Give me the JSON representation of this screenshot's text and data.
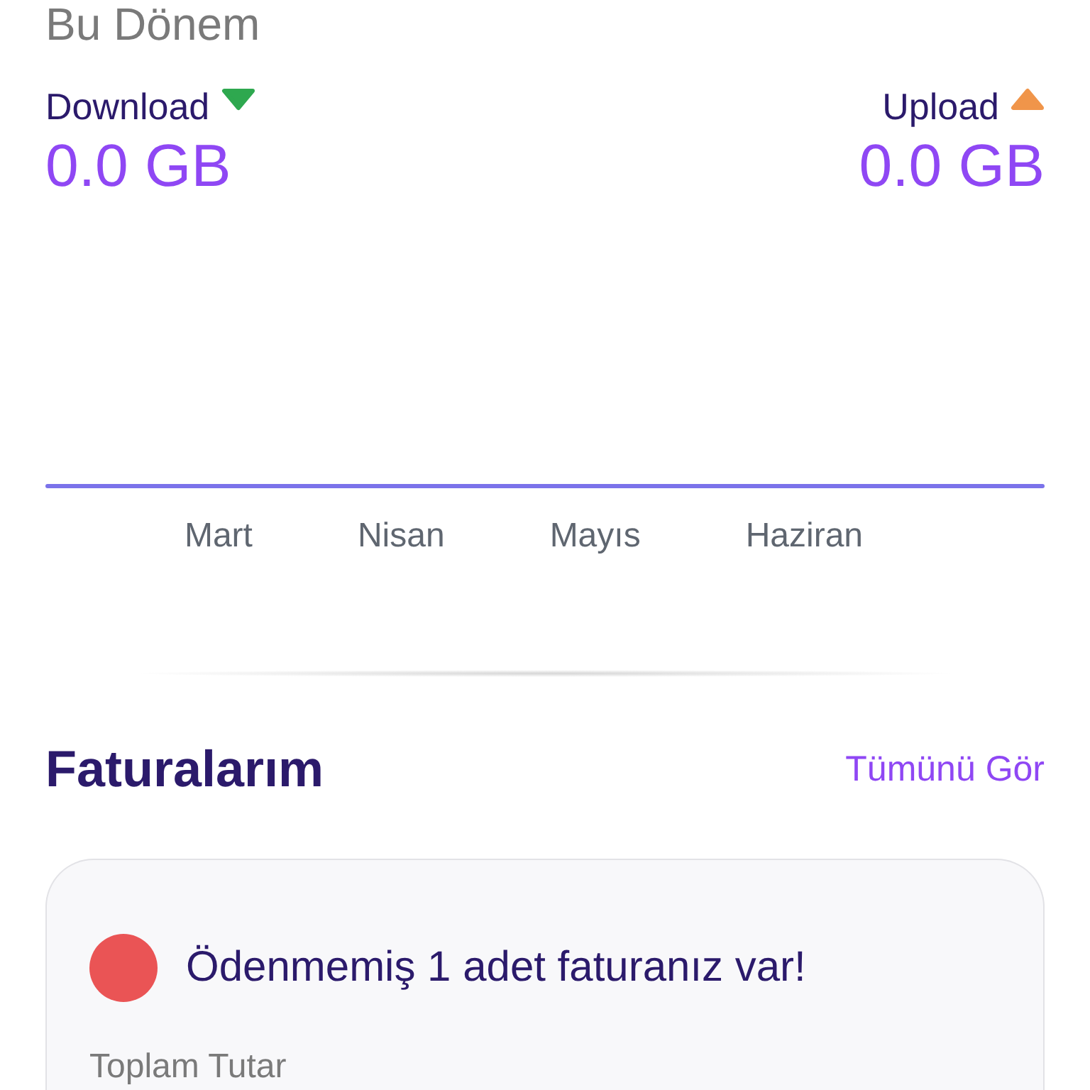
{
  "period_title": "Bu Dönem",
  "usage": [
    {
      "label": "Download",
      "kind": "down",
      "color": "#2ea84f",
      "value": "0.0 GB"
    },
    {
      "label": "Upload",
      "kind": "up",
      "color": "#f0954a",
      "value": "0.0 GB"
    }
  ],
  "chart": {
    "months": [
      "Mart",
      "Nisan",
      "Mayıs",
      "Haziran"
    ]
  },
  "invoices": {
    "title": "Faturalarım",
    "see_all": "Tümünü Gör",
    "alert": {
      "color": "#ea5455",
      "text": "Ödenmemiş 1 adet faturanız var!"
    },
    "total_label": "Toplam Tutar"
  }
}
